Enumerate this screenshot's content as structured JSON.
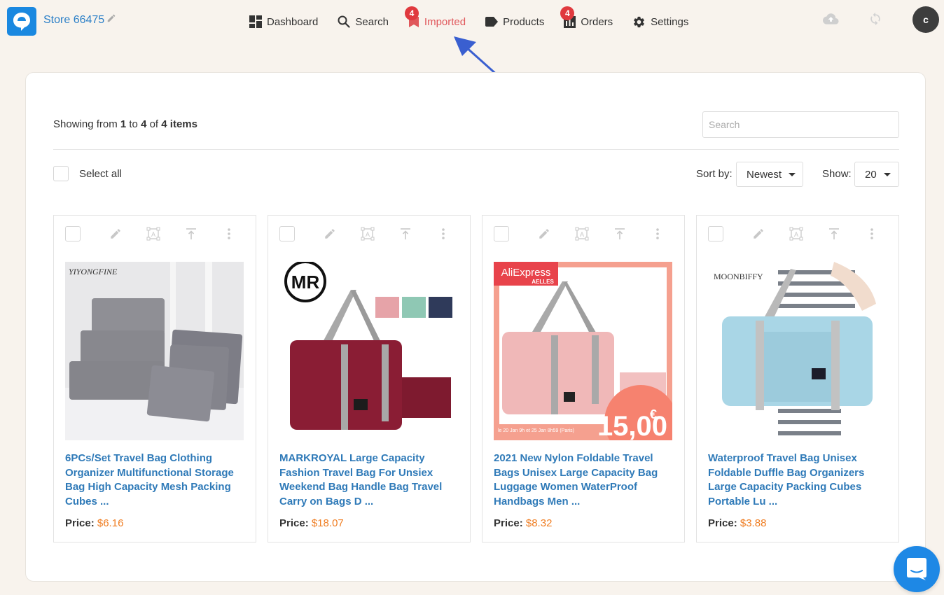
{
  "header": {
    "store_name": "Store 66475",
    "nav": [
      {
        "label": "Dashboard",
        "icon": "dashboard-icon"
      },
      {
        "label": "Search",
        "icon": "search-icon"
      },
      {
        "label": "Imported",
        "icon": "bookmark-icon",
        "badge": "4",
        "active": true
      },
      {
        "label": "Products",
        "icon": "tag-icon"
      },
      {
        "label": "Orders",
        "icon": "orders-icon",
        "badge": "4"
      },
      {
        "label": "Settings",
        "icon": "gear-icon"
      }
    ],
    "avatar_initial": "c"
  },
  "toolbar": {
    "showing_prefix": "Showing from ",
    "showing_from": "1",
    "showing_to_word": " to ",
    "showing_to": "4",
    "showing_of_word": " of ",
    "showing_total": "4",
    "showing_suffix": " items",
    "search_placeholder": "Search",
    "search_value": "",
    "select_all_label": "Select all",
    "sort_label": "Sort by:",
    "sort_value": "Newest",
    "show_label": "Show:",
    "show_value": "20"
  },
  "products": [
    {
      "title": "6PCs/Set Travel Bag Clothing Organizer Multifunctional Storage Bag High Capacity Mesh Packing Cubes ...",
      "price_label": "Price:",
      "price": "$6.16",
      "image_brand": "YIYONGFINE"
    },
    {
      "title": "MARKROYAL Large Capacity Fashion Travel Bag For Unsiex Weekend Bag Handle Bag Travel Carry on Bags D ...",
      "price_label": "Price:",
      "price": "$18.07",
      "image_brand": "MR"
    },
    {
      "title": "2021 New Nylon Foldable Travel Bags Unisex Large Capacity Bag Luggage Women WaterProof Handbags Men ...",
      "price_label": "Price:",
      "price": "$8.32",
      "image_brand": "AliExpress",
      "image_sub": "AELLES",
      "image_promo": "15,00",
      "image_currency": "€",
      "image_caption": "le 20 Jan 9h et 25 Jan 8h59 (Paris)"
    },
    {
      "title": "Waterproof Travel Bag Unisex Foldable Duffle Bag Organizers Large Capacity Packing Cubes Portable Lu ...",
      "price_label": "Price:",
      "price": "$3.88",
      "image_brand": "MOONBIFFY"
    }
  ],
  "colors": {
    "accent_blue": "#1a88e0",
    "link_blue": "#2f7ab8",
    "active_red": "#e0575b",
    "badge_red": "#e0393e",
    "price_orange": "#ef7d22",
    "page_bg": "#f8f3ed",
    "arrow_blue": "#3a5fd0"
  }
}
